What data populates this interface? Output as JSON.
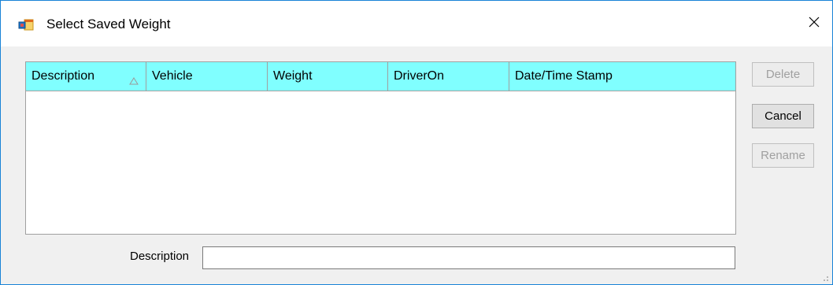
{
  "window": {
    "title": "Select Saved Weight",
    "icon": "form-window-icon",
    "close_icon": "close-icon"
  },
  "grid": {
    "header_color": "#80ffff",
    "columns": [
      {
        "label": "Description",
        "sorted": "ascending"
      },
      {
        "label": "Vehicle"
      },
      {
        "label": "Weight"
      },
      {
        "label": "DriverOn"
      },
      {
        "label": "Date/Time Stamp"
      }
    ],
    "rows": []
  },
  "buttons": {
    "delete_label": "Delete",
    "cancel_label": "Cancel",
    "rename_label": "Rename"
  },
  "form": {
    "description_label": "Description",
    "description_value": ""
  },
  "colors": {
    "window_border": "#1883d7",
    "header_background": "#80ffff"
  }
}
